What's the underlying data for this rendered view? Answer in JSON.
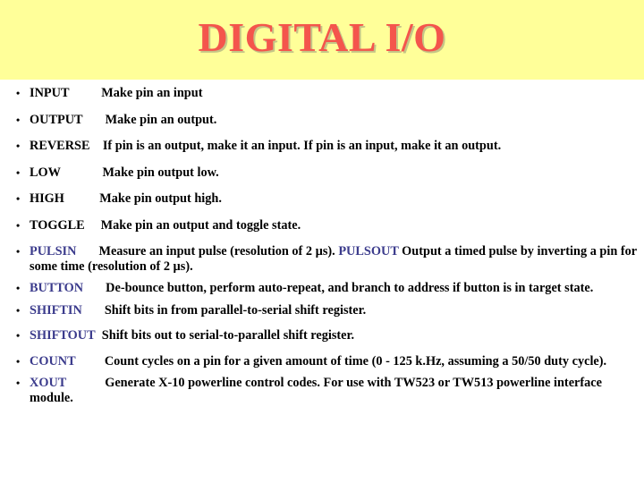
{
  "slide": {
    "title": "DIGITAL I/O",
    "title_color": "#f4554c",
    "header_background": "#ffff99",
    "body_background": "#ffffff",
    "keyword_navy_color": "#3b3b8c",
    "keyword_black_color": "#000000",
    "bullet_glyph": "•"
  },
  "items": [
    {
      "keyword": "INPUT",
      "keyword_color": "#000000",
      "description": "Make pin an input"
    },
    {
      "keyword": "OUTPUT",
      "keyword_color": "#000000",
      "description": "Make pin an output."
    },
    {
      "keyword": "REVERSE",
      "keyword_color": "#000000",
      "description": "If pin is an output, make it an input. If pin is an  input, make it an output."
    },
    {
      "keyword": "LOW",
      "keyword_color": "#000000",
      "description": "Make pin output low."
    },
    {
      "keyword": "HIGH",
      "keyword_color": "#000000",
      "description": "Make pin output high."
    },
    {
      "keyword": "TOGGLE",
      "keyword_color": "#000000",
      "description": "Make pin an output and toggle state."
    },
    {
      "keyword": "PULSIN",
      "keyword_color": "#3b3b8c",
      "description_part1": "Measure an input pulse (resolution of 2 µs). ",
      "inline_keyword": "PULSOUT",
      "description_part2": " Output a timed pulse by inverting a pin for some time (resolution of 2 µs)."
    },
    {
      "keyword": "BUTTON",
      "keyword_color": "#3b3b8c",
      "description": "De-bounce button, perform auto-repeat, and branch  to address if button is in target state."
    },
    {
      "keyword": "SHIFTIN",
      "keyword_color": "#3b3b8c",
      "description": "Shift bits in from parallel-to-serial shift register."
    },
    {
      "keyword": "SHIFTOUT",
      "keyword_color": "#3b3b8c",
      "description": "Shift bits out to serial-to-parallel shift register."
    },
    {
      "keyword": "COUNT",
      "keyword_color": "#3b3b8c",
      "description": "Count cycles on a pin for a given amount of time  (0 - 125 k.Hz, assuming a 50/50 duty cycle)."
    },
    {
      "keyword": "XOUT",
      "keyword_color": "#3b3b8c",
      "description": "Generate X-10 powerline control codes. For use with TW523 or TW513 powerline interface module."
    }
  ]
}
